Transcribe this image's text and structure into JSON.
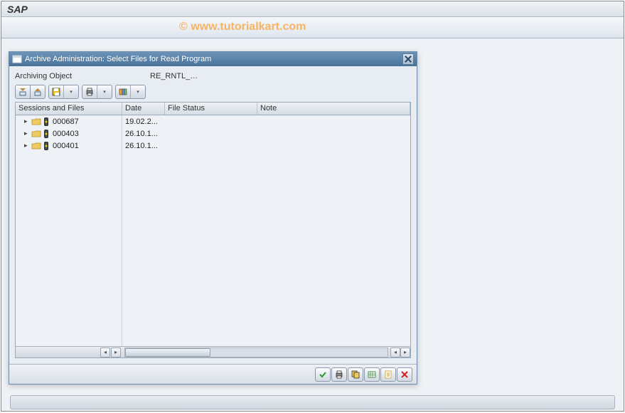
{
  "app": {
    "title": "SAP"
  },
  "watermark": "© www.tutorialkart.com",
  "dialog": {
    "title": "Archive Administration: Select Files for Read Program",
    "field_label": "Archiving Object",
    "field_value": "RE_RNTL_…",
    "columns": {
      "sessions": "Sessions and Files",
      "date": "Date",
      "status": "File Status",
      "note": "Note"
    },
    "rows": [
      {
        "id": "000687",
        "date": "19.02.2..."
      },
      {
        "id": "000403",
        "date": "26.10.1..."
      },
      {
        "id": "000401",
        "date": "26.10.1..."
      }
    ]
  },
  "icons": {
    "expand_all": "expand-all-icon",
    "collapse_all": "collapse-all-icon",
    "save": "save-icon",
    "print": "print-icon",
    "layout": "layout-icon",
    "ok": "check-icon",
    "print2": "print-icon",
    "copy": "copy-icon",
    "table": "table-icon",
    "doc": "document-icon",
    "cancel": "cancel-icon"
  }
}
